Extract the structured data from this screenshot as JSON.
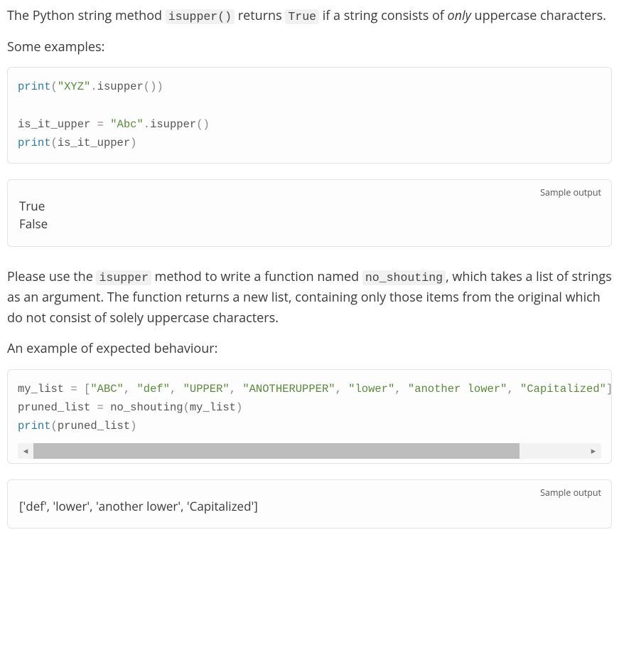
{
  "intro": {
    "p1_pre": "The Python string method ",
    "p1_code1": "isupper()",
    "p1_mid": " returns ",
    "p1_code2": "True",
    "p1_post1": " if a string consists of ",
    "p1_em": "only",
    "p1_post2": " uppercase characters.",
    "p2": "Some examples:"
  },
  "code1": {
    "l1_fn": "print",
    "l1_p1": "(",
    "l1_str": "\"XYZ\"",
    "l1_dot": ".",
    "l1_m": "isupper",
    "l1_p2": "())",
    "l2": "",
    "l3_id": "is_it_upper",
    "l3_eq": " = ",
    "l3_str": "\"Abc\"",
    "l3_dot": ".",
    "l3_m": "isupper",
    "l3_p": "()",
    "l4_fn": "print",
    "l4_p1": "(",
    "l4_id": "is_it_upper",
    "l4_p2": ")"
  },
  "output1": {
    "label": "Sample output",
    "text": "True\nFalse"
  },
  "task": {
    "p1_pre": "Please use the ",
    "p1_code1": "isupper",
    "p1_mid": " method to write a function named ",
    "p1_code2": "no_shouting",
    "p1_post": ", which takes a list of strings as an argument. The function returns a new list, containing only those items from the original which do not consist of solely uppercase characters.",
    "p2": "An example of expected behaviour:"
  },
  "code2": {
    "l1_id": "my_list",
    "l1_eq": " = ",
    "l1_b1": "[",
    "l1_s1": "\"ABC\"",
    "l1_c": ", ",
    "l1_s2": "\"def\"",
    "l1_s3": "\"UPPER\"",
    "l1_s4": "\"ANOTHERUPPER\"",
    "l1_s5": "\"lower\"",
    "l1_s6": "\"another lower\"",
    "l1_s7": "\"Capitalized\"",
    "l1_b2": "]",
    "l2_id": "pruned_list",
    "l2_eq": " = ",
    "l2_fn": "no_shouting",
    "l2_p1": "(",
    "l2_arg": "my_list",
    "l2_p2": ")",
    "l3_fn": "print",
    "l3_p1": "(",
    "l3_arg": "pruned_list",
    "l3_p2": ")"
  },
  "output2": {
    "label": "Sample output",
    "text": "['def', 'lower', 'another lower', 'Capitalized']"
  }
}
